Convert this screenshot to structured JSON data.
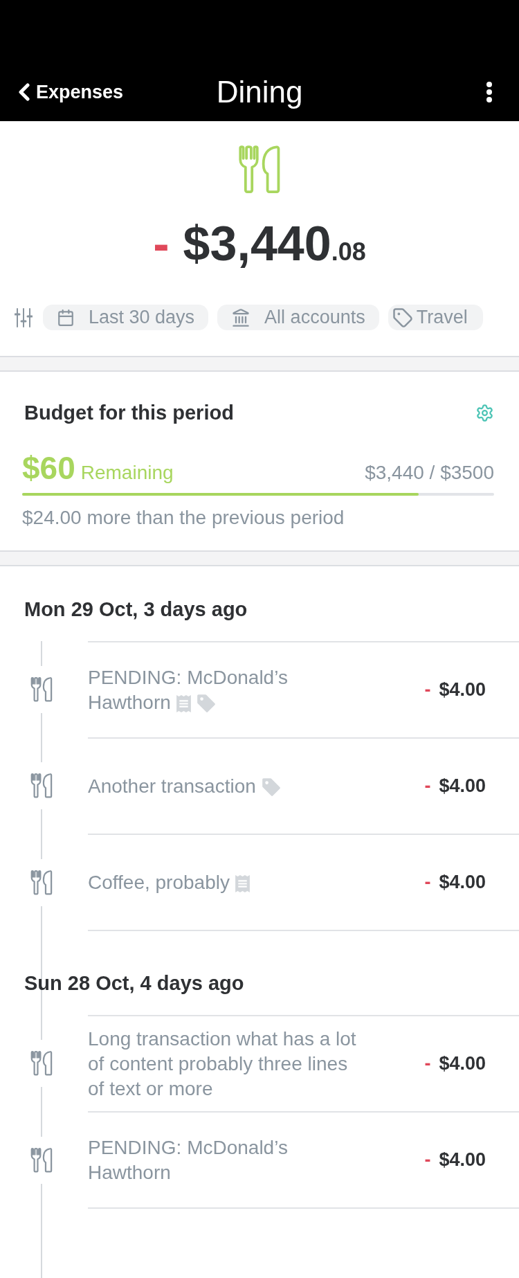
{
  "nav": {
    "back_label": "Expenses",
    "title": "Dining"
  },
  "summary": {
    "sign": "-",
    "whole": "$3,440",
    "cents": ".08"
  },
  "filters": [
    {
      "kind": "date",
      "label": "Last 30 days"
    },
    {
      "kind": "account",
      "label": "All accounts"
    },
    {
      "kind": "tag",
      "label": "Travel"
    }
  ],
  "budget": {
    "title": "Budget for this period",
    "remaining_amount": "$60",
    "remaining_label": "Remaining",
    "spent_of_total": "$3,440 / $3500",
    "level": 0.84,
    "comparison": "$24.00 more than the previous period"
  },
  "groups": [
    {
      "date": "Mon 29 Oct, 3 days ago",
      "transactions": [
        {
          "description": "PENDING: McDonald’s Hawthorn",
          "has_receipt": true,
          "has_tag": true,
          "sign": "-",
          "amount": "$4.00"
        },
        {
          "description": "Another transaction",
          "has_receipt": false,
          "has_tag": true,
          "sign": "-",
          "amount": "$4.00"
        },
        {
          "description": "Coffee, probably",
          "has_receipt": true,
          "has_tag": false,
          "sign": "-",
          "amount": "$4.00"
        }
      ]
    },
    {
      "date": "Sun 28 Oct, 4 days ago",
      "transactions": [
        {
          "description": "Long transaction what has a lot of content probably three lines of text or more",
          "has_receipt": false,
          "has_tag": false,
          "sign": "-",
          "amount": "$4.00"
        },
        {
          "description": "PENDING: McDonald’s Hawthorn",
          "has_receipt": false,
          "has_tag": false,
          "sign": "-",
          "amount": "$4.00"
        }
      ]
    }
  ]
}
